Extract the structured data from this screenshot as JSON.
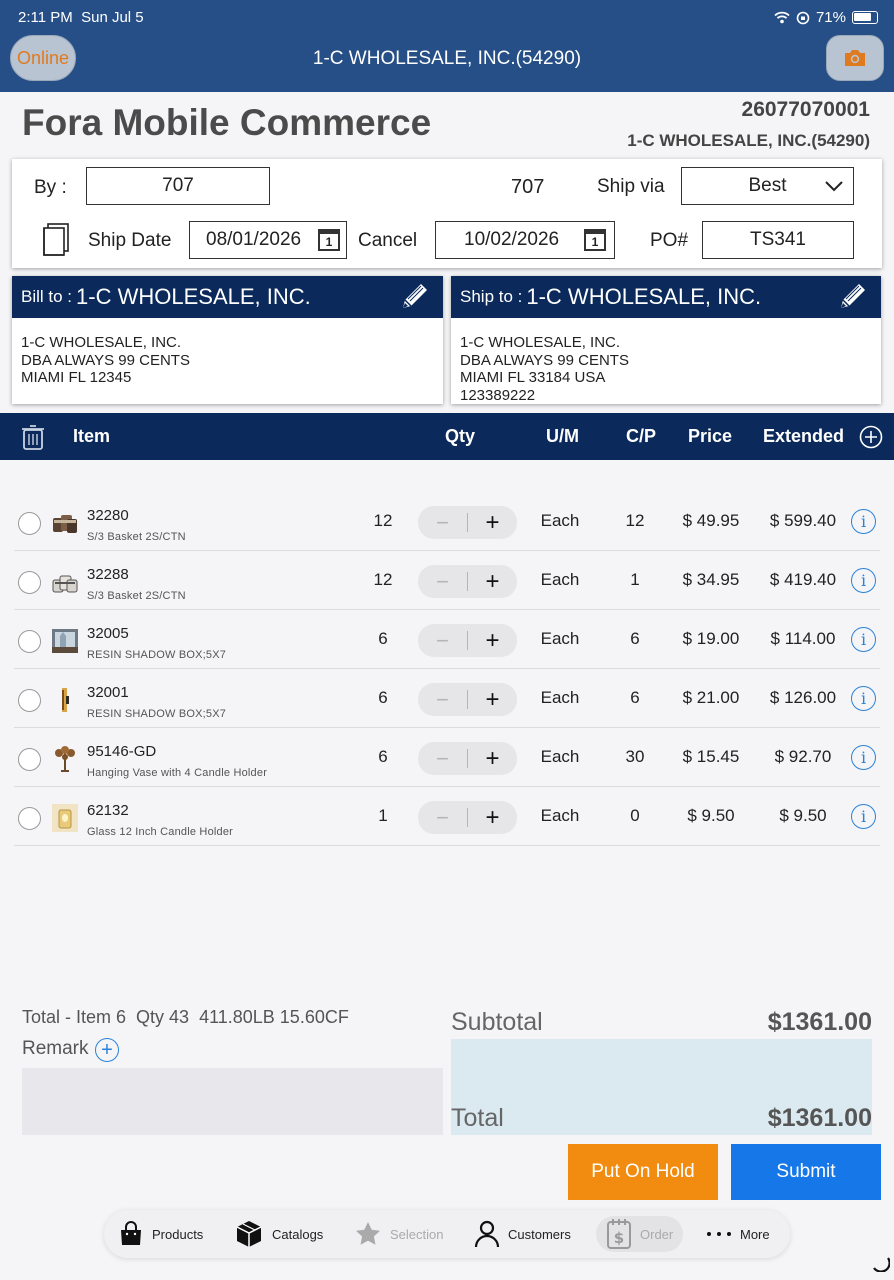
{
  "status": {
    "time": "2:11 PM",
    "date": "Sun Jul 5",
    "battery": "71%"
  },
  "header": {
    "online": "Online",
    "title": "1-C WHOLESALE, INC.(54290)"
  },
  "app_title": "Fora Mobile Commerce",
  "order_number": "26077070001",
  "customer_line": "1-C WHOLESALE, INC.(54290)",
  "form": {
    "by_label": "By :",
    "by_value": "707",
    "rep_code": "707",
    "ship_via_label": "Ship via",
    "ship_via_value": "Best",
    "ship_date_label": "Ship Date",
    "ship_date_value": "08/01/2026",
    "cancel_label": "Cancel",
    "cancel_value": "10/02/2026",
    "po_label": "PO#",
    "po_value": "TS341",
    "calendar_day": "1"
  },
  "bill_to": {
    "prefix": "Bill to :",
    "name": "1-C WHOLESALE, INC.",
    "lines": [
      "1-C WHOLESALE, INC.",
      "DBA ALWAYS 99 CENTS",
      "MIAMI FL 12345"
    ]
  },
  "ship_to": {
    "prefix": "Ship to :",
    "name": "1-C WHOLESALE, INC.",
    "lines": [
      "1-C WHOLESALE, INC.",
      "DBA ALWAYS 99 CENTS",
      "MIAMI FL 33184 USA",
      "123389222"
    ]
  },
  "table": {
    "headers": {
      "item": "Item",
      "qty": "Qty",
      "um": "U/M",
      "cp": "C/P",
      "price": "Price",
      "extended": "Extended"
    },
    "rows": [
      {
        "code": "32280",
        "desc": "S/3 Basket 2S/CTN",
        "qty": "12",
        "um": "Each",
        "cp": "12",
        "price": "$ 49.95",
        "extended": "$ 599.40"
      },
      {
        "code": "32288",
        "desc": "S/3 Basket 2S/CTN",
        "qty": "12",
        "um": "Each",
        "cp": "1",
        "price": "$ 34.95",
        "extended": "$ 419.40"
      },
      {
        "code": "32005",
        "desc": "RESIN SHADOW BOX;5X7",
        "qty": "6",
        "um": "Each",
        "cp": "6",
        "price": "$ 19.00",
        "extended": "$ 114.00"
      },
      {
        "code": "32001",
        "desc": "RESIN SHADOW BOX;5X7",
        "qty": "6",
        "um": "Each",
        "cp": "6",
        "price": "$ 21.00",
        "extended": "$ 126.00"
      },
      {
        "code": "95146-GD",
        "desc": "Hanging Vase with 4 Candle Holder",
        "qty": "6",
        "um": "Each",
        "cp": "30",
        "price": "$ 15.45",
        "extended": "$ 92.70"
      },
      {
        "code": "62132",
        "desc": "Glass 12 Inch Candle Holder",
        "qty": "1",
        "um": "Each",
        "cp": "0",
        "price": "$ 9.50",
        "extended": "$ 9.50"
      }
    ],
    "stepper_minus": "−",
    "stepper_plus": "+",
    "info": "i"
  },
  "summary": {
    "line": "Total - Item 6  Qty 43  411.80LB 15.60CF",
    "remark_label": "Remark",
    "remark_plus": "+",
    "subtotal_label": "Subtotal",
    "subtotal_value": "$1361.00",
    "total_label": "Total",
    "total_value": "$1361.00"
  },
  "actions": {
    "hold": "Put On Hold",
    "submit": "Submit"
  },
  "tabs": {
    "products": "Products",
    "catalogs": "Catalogs",
    "selection": "Selection",
    "customers": "Customers",
    "order": "Order",
    "more": "More"
  },
  "colors": {
    "header": "#254f86",
    "navy": "#0b2a5b",
    "orange": "#f28c10",
    "blue": "#1678e8",
    "accent": "#2a82d8"
  }
}
